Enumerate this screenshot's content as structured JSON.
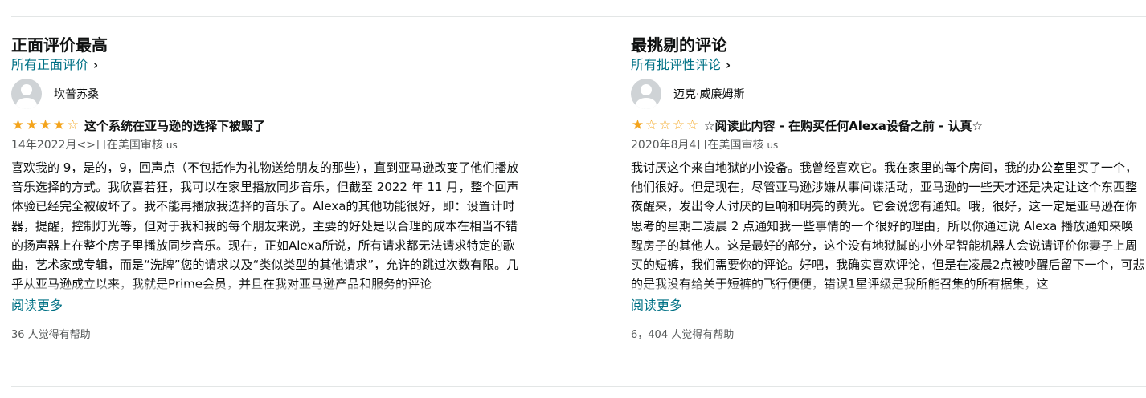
{
  "positive": {
    "heading": "正面评价最高",
    "all_link": "所有正面评价",
    "chevron": "›",
    "reviewer": "坎普苏桑",
    "rating": 4,
    "title": "这个系统在亚马逊的选择下被毁了",
    "date": "14年2022月<>日在美国审核",
    "country": "us",
    "body": "喜欢我的 9，是的，9，回声点（不包括作为礼物送给朋友的那些），直到亚马逊改变了他们播放音乐选择的方式。我欣喜若狂，我可以在家里播放同步音乐，但截至 2022 年 11 月，整个回声体验已经完全被破坏了。我不能再播放我选择的音乐了。Alexa的其他功能很好，即：设置计时器，提醒，控制灯光等，但对于我和我的每个朋友来说，主要的好处是以合理的成本在相当不错的扬声器上在整个房子里播放同步音乐。现在，正如Alexa所说，所有请求都无法请求特定的歌曲，艺术家或专辑，而是“洗牌”您的请求以及“类似类型的其他请求”，允许的跳过次数有限。几乎从亚马逊成立以来，我就是Prime会员，并且在我对亚马逊产品和服务的评论",
    "read_more": "阅读更多",
    "helpful": "36 人觉得有帮助"
  },
  "critical": {
    "heading": "最挑剔的评论",
    "all_link": "所有批评性评论",
    "chevron": "›",
    "reviewer": "迈克·威廉姆斯",
    "rating": 1,
    "title": "☆阅读此内容 - 在购买任何Alexa设备之前 - 认真☆",
    "date": "2020年8月4日在美国审核",
    "country": "us",
    "body": "我讨厌这个来自地狱的小设备。我曾经喜欢它。我在家里的每个房间，我的办公室里买了一个，他们很好。但是现在，尽管亚马逊涉嫌从事间谍活动，亚马逊的一些天才还是决定让这个东西整夜醒来，发出令人讨厌的巨响和明亮的黄光。它会说您有通知。哦，很好，这一定是亚马逊在你思考的星期二凌晨 2 点通知我一些事情的一个很好的理由，所以你通过说 Alexa 播放通知来唤醒房子的其他人。这是最好的部分，这个没有地狱脚的小外星智能机器人会说请评价你妻子上周买的短裤，我们需要你的评论。好吧，我确实喜欢评论，但是在凌晨2点被吵醒后留下一个，可悲的是我没有给关于短裤的飞行便便，错误1星评级是我所能召集的所有据集，这",
    "read_more": "阅读更多",
    "helpful": "6，404 人觉得有帮助"
  },
  "colors": {
    "link": "#007185",
    "star": "#f4a41c",
    "muted": "#565959"
  },
  "icons": {
    "avatar": "person-avatar-icon",
    "star_full": "★",
    "star_empty": "☆"
  }
}
